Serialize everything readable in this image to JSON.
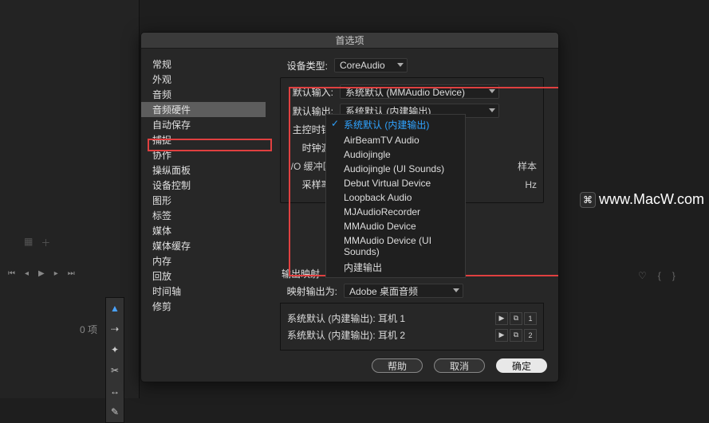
{
  "watermark": "www.MacW.com",
  "bg": {
    "items_text": "0 项"
  },
  "dialog": {
    "title": "首选项",
    "sidebar": [
      "常规",
      "外观",
      "音频",
      "音频硬件",
      "自动保存",
      "捕捉",
      "协作",
      "操纵面板",
      "设备控制",
      "图形",
      "标签",
      "媒体",
      "媒体缓存",
      "内存",
      "回放",
      "时间轴",
      "修剪"
    ],
    "selected_sidebar_index": 3,
    "device_type": {
      "label": "设备类型:",
      "value": "CoreAudio"
    },
    "default_input": {
      "label": "默认输入:",
      "value": "系统默认 (MMAudio Device)"
    },
    "default_output": {
      "label": "默认输出:",
      "value": "系统默认 (内建输出)"
    },
    "master_clock": {
      "label": "主控时钟:"
    },
    "clock_source": {
      "label": "时钟源:"
    },
    "io_buffer": {
      "label": "I/O 缓冲区大小:",
      "unit": "样本"
    },
    "sample_rate": {
      "label": "采样率:",
      "unit": "Hz"
    },
    "dropdown_options": [
      "系统默认 (内建输出)",
      "AirBeamTV Audio",
      "Audiojingle",
      "Audiojingle (UI Sounds)",
      "Debut Virtual Device",
      "Loopback Audio",
      "MJAudioRecorder",
      "MMAudio Device",
      "MMAudio Device (UI Sounds)",
      "内建输出"
    ],
    "dropdown_selected_index": 0,
    "output_mapping": {
      "title": "输出映射",
      "map_to": {
        "label": "映射输出为:",
        "value": "Adobe 桌面音频"
      },
      "rows": [
        {
          "text": "系统默认 (内建输出): 耳机 1",
          "num": "1"
        },
        {
          "text": "系统默认 (内建输出): 耳机 2",
          "num": "2"
        }
      ]
    },
    "buttons": {
      "help": "帮助",
      "cancel": "取消",
      "ok": "确定"
    }
  }
}
